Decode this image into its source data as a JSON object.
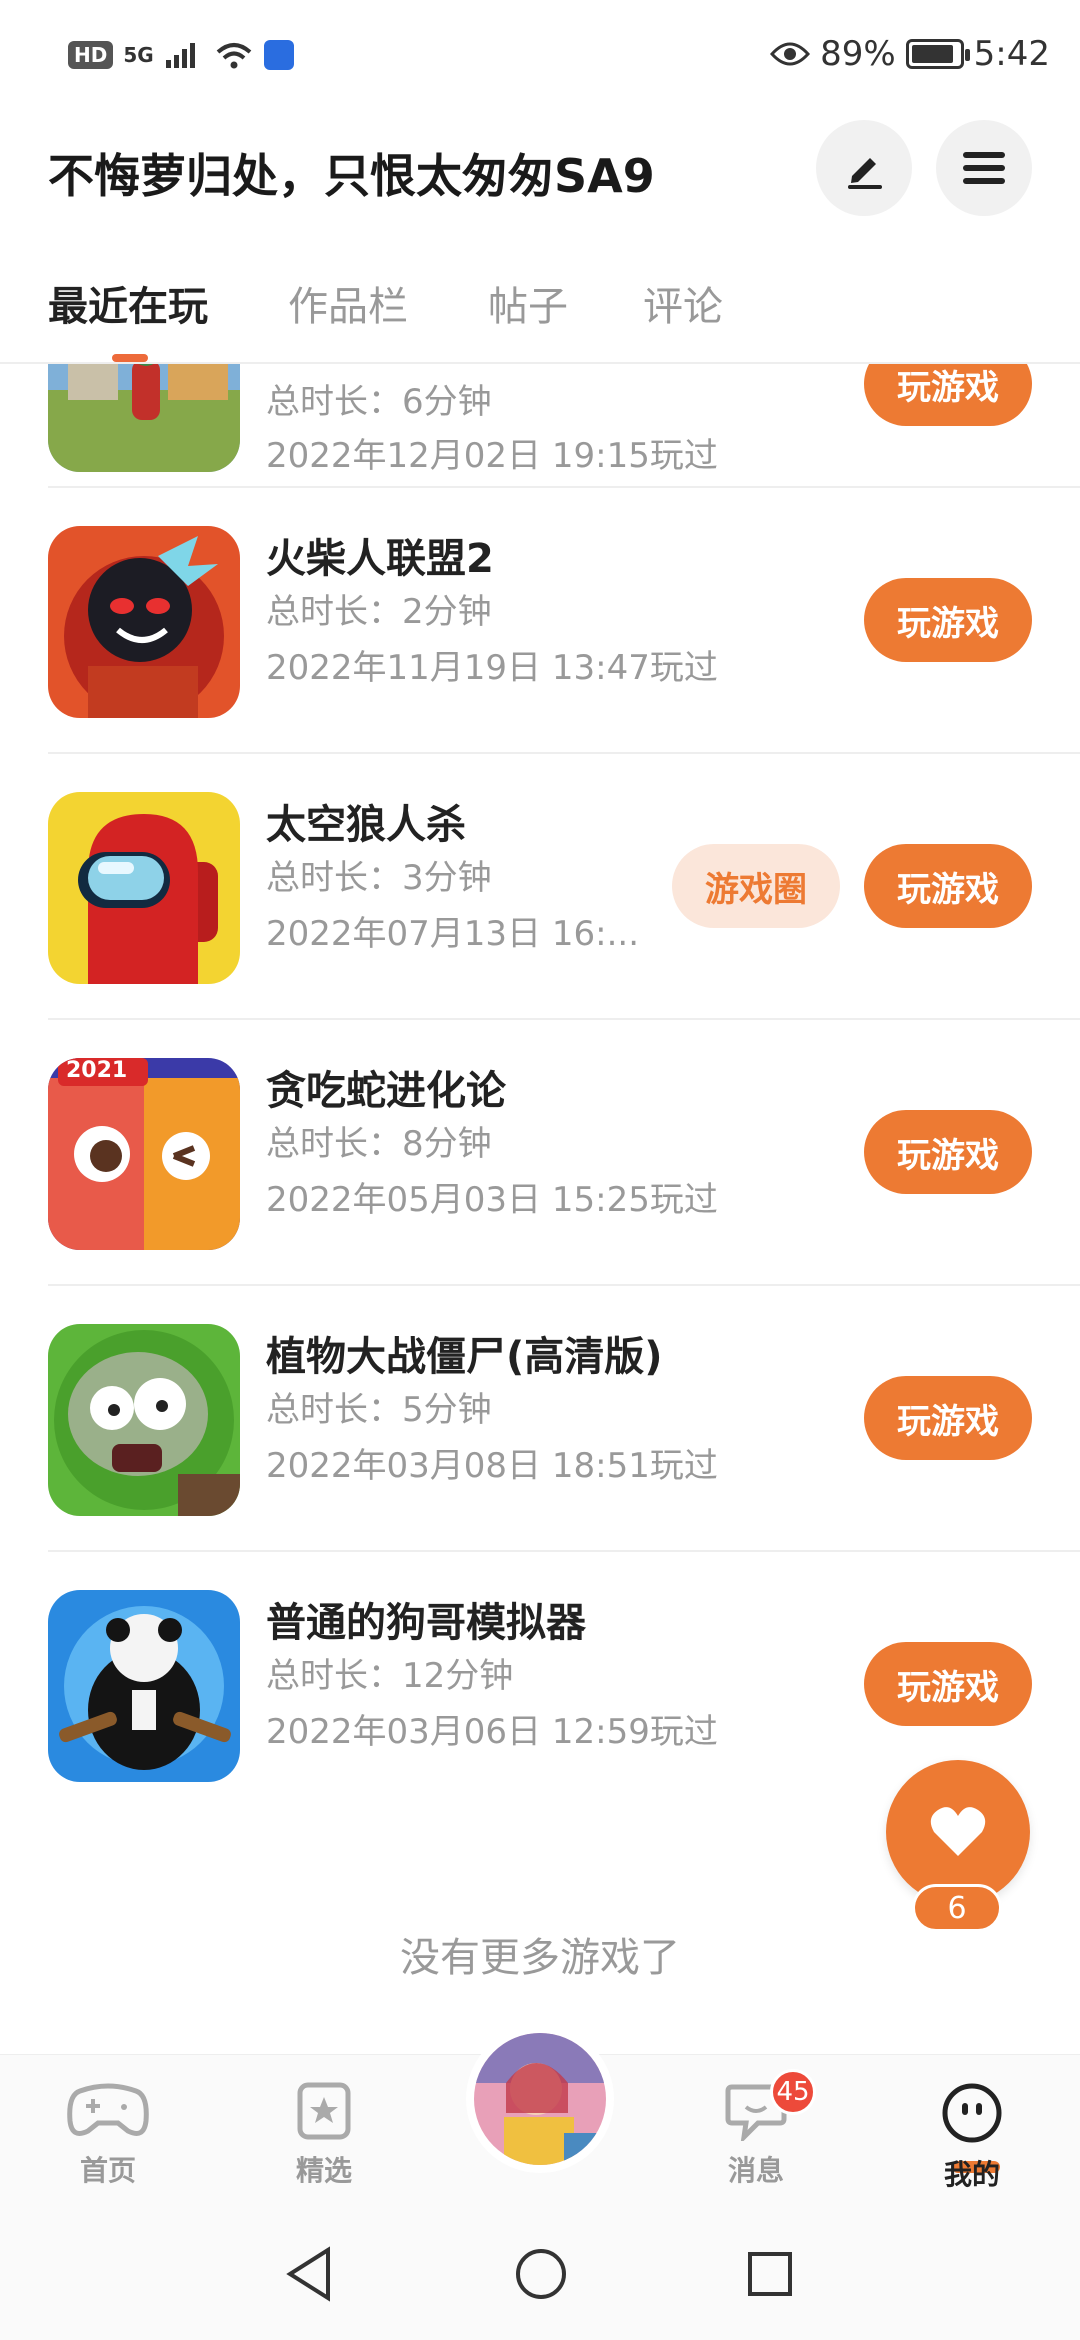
{
  "status_bar": {
    "hd": "HD",
    "signal": "5G",
    "battery_pct": "89%",
    "time": "5:42",
    "battery_level": 0.89
  },
  "header": {
    "profile_name": "不悔萝归处，只恨太匆匆SA9",
    "edit_icon": "pencil-icon",
    "menu_icon": "hamburger-menu-icon"
  },
  "tabs": [
    {
      "label": "最近在玩",
      "active": true
    },
    {
      "label": "作品栏",
      "active": false
    },
    {
      "label": "帖子",
      "active": false
    },
    {
      "label": "评论",
      "active": false
    }
  ],
  "games": [
    {
      "title": "",
      "duration": "总时长：6分钟",
      "played": "2022年12月02日 19:15玩过",
      "play_label": "玩游戏",
      "circle_label": ""
    },
    {
      "title": "火柴人联盟2",
      "duration": "总时长：2分钟",
      "played": "2022年11月19日 13:47玩过",
      "play_label": "玩游戏",
      "circle_label": ""
    },
    {
      "title": "太空狼人杀",
      "duration": "总时长：3分钟",
      "played": "2022年07月13日 16:...",
      "play_label": "玩游戏",
      "circle_label": "游戏圈"
    },
    {
      "title": "贪吃蛇进化论",
      "duration": "总时长：8分钟",
      "played": "2022年05月03日 15:25玩过",
      "play_label": "玩游戏",
      "circle_label": ""
    },
    {
      "title": "植物大战僵尸(高清版)",
      "duration": "总时长：5分钟",
      "played": "2022年03月08日 18:51玩过",
      "play_label": "玩游戏",
      "circle_label": ""
    },
    {
      "title": "普通的狗哥模拟器",
      "duration": "总时长：12分钟",
      "played": "2022年03月06日 12:59玩过",
      "play_label": "玩游戏",
      "circle_label": ""
    }
  ],
  "thumb_badge": "2021",
  "no_more": "没有更多游戏了",
  "like": {
    "count": "6",
    "icon": "heart-icon"
  },
  "bottom_nav": {
    "home": "首页",
    "featured": "精选",
    "messages": "消息",
    "messages_badge": "45",
    "mine": "我的"
  },
  "colors": {
    "accent": "#ed7a33",
    "accent_light": "#fbe6da",
    "badge_red": "#ed4a3a"
  }
}
